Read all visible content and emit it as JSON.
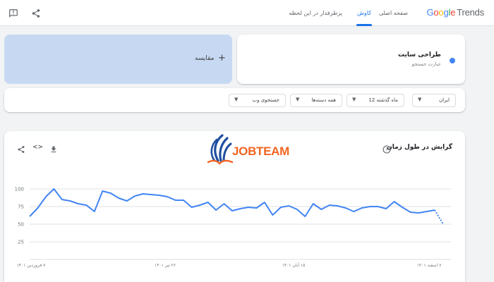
{
  "header": {
    "logo_google": [
      "G",
      "o",
      "o",
      "g",
      "l",
      "e"
    ],
    "logo_trends": "Trends",
    "nav": [
      {
        "label": "صفحه اصلی"
      },
      {
        "label": "کاوش"
      },
      {
        "label": "پرطرفدار در این لحظه"
      }
    ],
    "active_nav": "کاوش"
  },
  "search_term": {
    "title": "طراحی سایت",
    "subtitle": "عبارت جستجو",
    "color": "#4285f4"
  },
  "compare": {
    "label": "مقایسه",
    "plus": "+"
  },
  "filters": {
    "region": "ایران",
    "time": "12 ماه گذشته",
    "category": "همه دسته‌ها",
    "search_type": "جستجوی وب",
    "caret": "▼"
  },
  "chart_card": {
    "title": "گرایش در طول زمان",
    "help": "?",
    "embed": "<>"
  },
  "watermark": {
    "text": "JOBTEAM"
  },
  "chart_data": {
    "type": "line",
    "title": "گرایش در طول زمان",
    "ylim": [
      0,
      100
    ],
    "yticks": [
      "100",
      "75",
      "50",
      "25"
    ],
    "grid": true,
    "legend": "none",
    "xticks": [
      "۷ فروردین ۱۴۰۱",
      "۲۶ تیر ۱۴۰۱",
      "۱۵ آبان ۱۴۰۱",
      "۷ اسفند ۱۴۰۱"
    ],
    "series": [
      {
        "color": "#4285f4",
        "values": [
          61,
          73,
          89,
          100,
          85,
          83,
          79,
          77,
          68,
          97,
          94,
          87,
          83,
          90,
          93,
          92,
          91,
          89,
          84,
          84,
          74,
          77,
          81,
          70,
          79,
          69,
          72,
          74,
          73,
          81,
          63,
          74,
          76,
          71,
          61,
          79,
          71,
          77,
          76,
          73,
          68,
          73,
          75,
          75,
          72,
          82,
          74,
          67,
          66,
          68,
          70
        ],
        "partial_values": [
          70,
          51
        ]
      }
    ]
  }
}
